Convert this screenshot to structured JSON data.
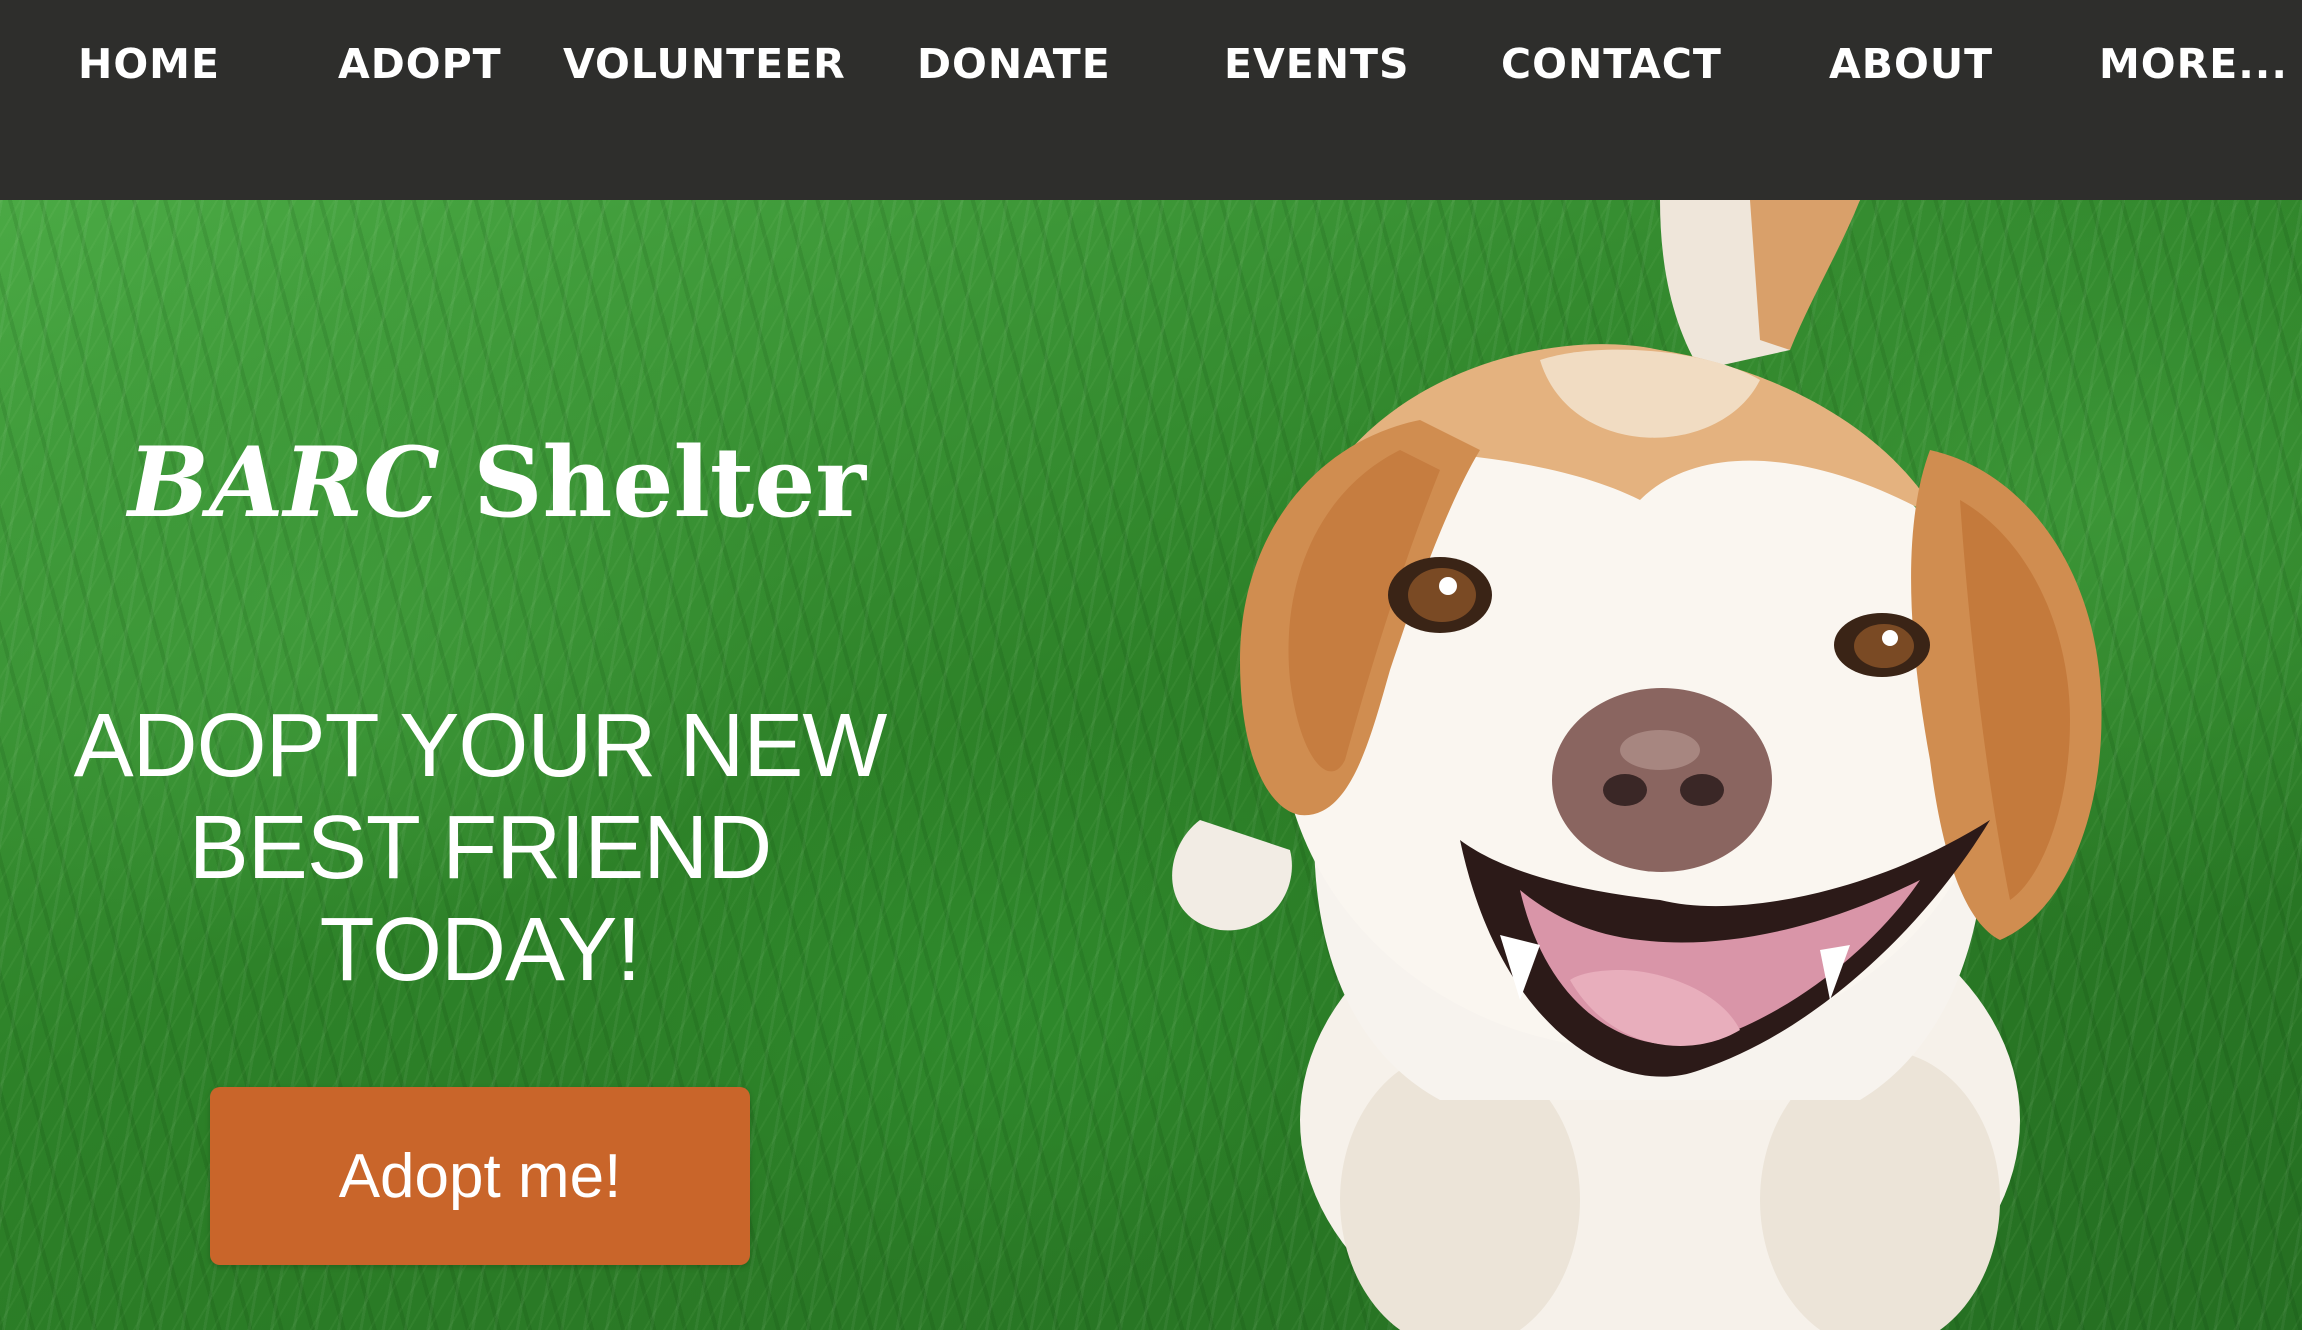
{
  "nav": {
    "items": [
      {
        "label": "HOME"
      },
      {
        "label": "ADOPT"
      },
      {
        "label": "VOLUNTEER"
      },
      {
        "label": "DONATE"
      },
      {
        "label": "EVENTS"
      },
      {
        "label": "CONTACT"
      },
      {
        "label": "ABOUT"
      },
      {
        "label": "MORE..."
      }
    ]
  },
  "hero": {
    "brand_italic": "BARC",
    "brand_rest": "Shelter",
    "headline_lines": [
      "ADOPT YOUR NEW",
      "BEST FRIEND",
      "TODAY!"
    ],
    "cta_label": "Adopt me!",
    "image_subject": "dog-photo"
  },
  "colors": {
    "nav_background": "#2e2e2c",
    "cta_background": "#c9652a",
    "text": "#ffffff",
    "grass": "#2e7d2a"
  }
}
